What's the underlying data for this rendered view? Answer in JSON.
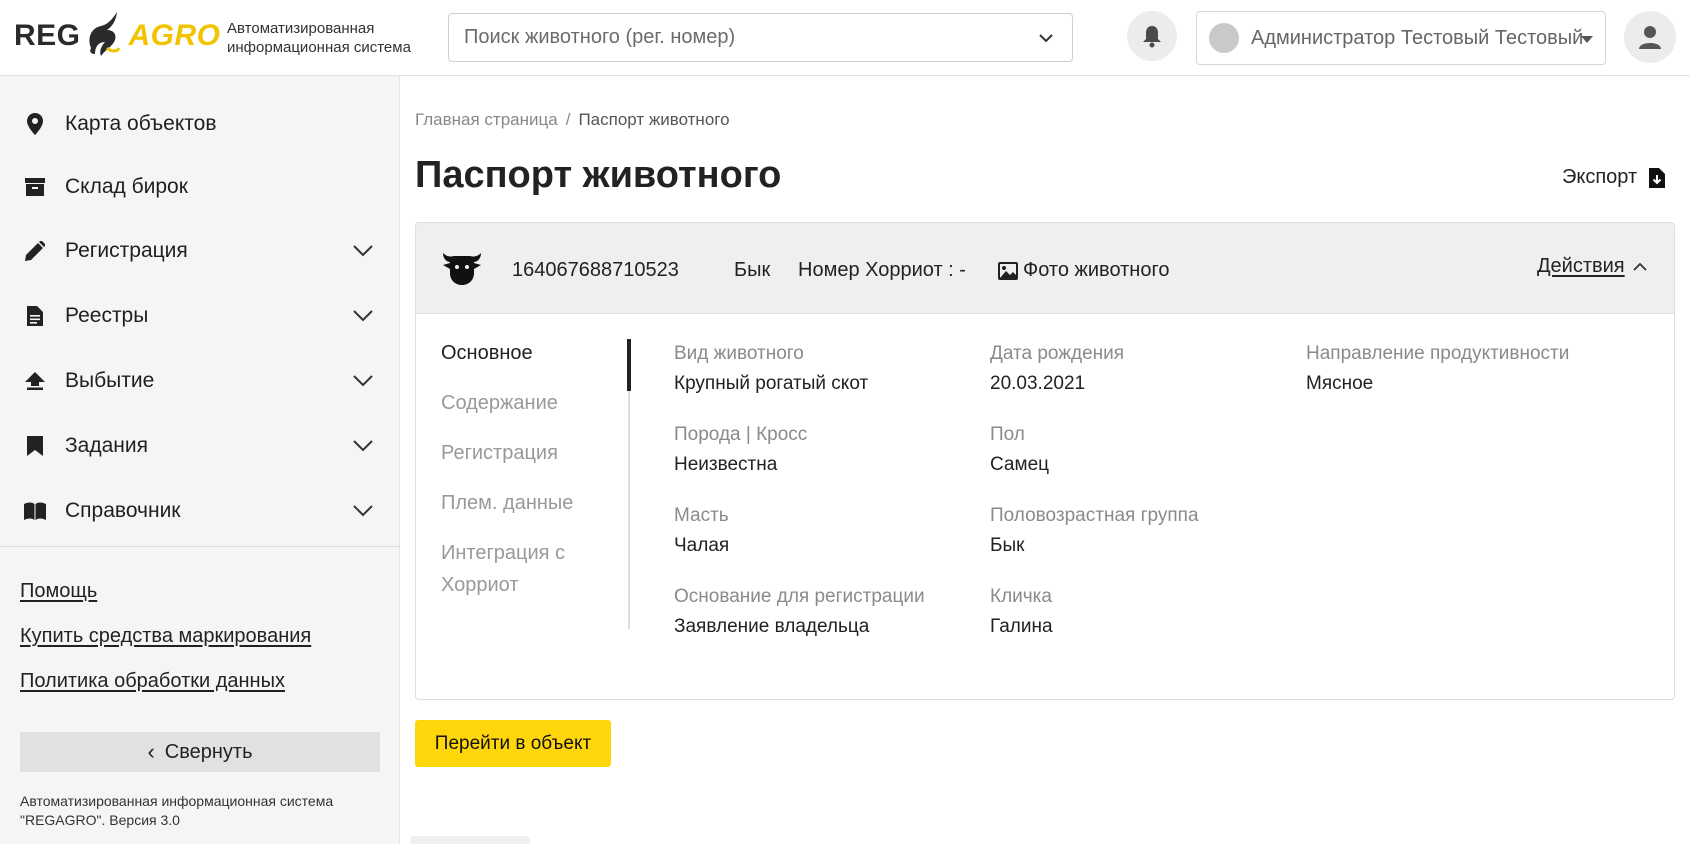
{
  "header": {
    "logo_left": "REG",
    "logo_right": "AGRO",
    "subtitle_line1": "Автоматизированная",
    "subtitle_line2": "информационная система",
    "search_placeholder": "Поиск животного (рег. номер)",
    "user_name": "Администратор Тестовый Тестовый"
  },
  "sidebar": {
    "items": [
      {
        "label": "Карта объектов",
        "icon": "map-pin-icon",
        "expandable": false
      },
      {
        "label": "Склад бирок",
        "icon": "archive-box-icon",
        "expandable": false
      },
      {
        "label": "Регистрация",
        "icon": "pencil-icon",
        "expandable": true
      },
      {
        "label": "Реестры",
        "icon": "document-icon",
        "expandable": true
      },
      {
        "label": "Выбытие",
        "icon": "upload-icon",
        "expandable": true
      },
      {
        "label": "Задания",
        "icon": "bookmark-icon",
        "expandable": true
      },
      {
        "label": "Справочник",
        "icon": "book-icon",
        "expandable": true
      }
    ],
    "links": [
      "Помощь",
      "Купить средства маркирования",
      "Политика обработки данных"
    ],
    "collapse_label": "Свернуть",
    "footer_line1": "Автоматизированная информационная система",
    "footer_line2": "\"REGAGRO\". Версия 3.0"
  },
  "breadcrumb": {
    "home": "Главная страница",
    "separator": "/",
    "current": "Паспорт животного"
  },
  "page": {
    "title": "Паспорт животного",
    "export_label": "Экспорт"
  },
  "animal": {
    "reg_number": "164067688710523",
    "gender_type": "Бык",
    "horriot_label": "Номер Хорриот : -",
    "photo_label": "Фото животного",
    "actions_label": "Действия"
  },
  "tabs": [
    {
      "label": "Основное",
      "active": true
    },
    {
      "label": "Содержание",
      "active": false
    },
    {
      "label": "Регистрация",
      "active": false
    },
    {
      "label": "Плем. данные",
      "active": false
    },
    {
      "label": "Интеграция с Хорриот",
      "active": false
    }
  ],
  "fields": [
    {
      "label": "Вид животного",
      "value": "Крупный рогатый скот"
    },
    {
      "label": "Дата рождения",
      "value": "20.03.2021"
    },
    {
      "label": "Направление продуктивности",
      "value": "Мясное"
    },
    {
      "label": "Порода | Кросс",
      "value": "Неизвестна"
    },
    {
      "label": "Пол",
      "value": "Самец"
    },
    {
      "label": "Масть",
      "value": "Чалая"
    },
    {
      "label": "Половозрастная группа",
      "value": "Бык"
    },
    {
      "label": "Основание для регистрации",
      "value": "Заявление владельца"
    },
    {
      "label": "Кличка",
      "value": "Галина"
    }
  ],
  "goto_button": "Перейти в объект",
  "colors": {
    "accent_yellow": "#ffd60a",
    "logo_yellow": "#f2c400",
    "sidebar_bg": "#f5f5f5"
  }
}
